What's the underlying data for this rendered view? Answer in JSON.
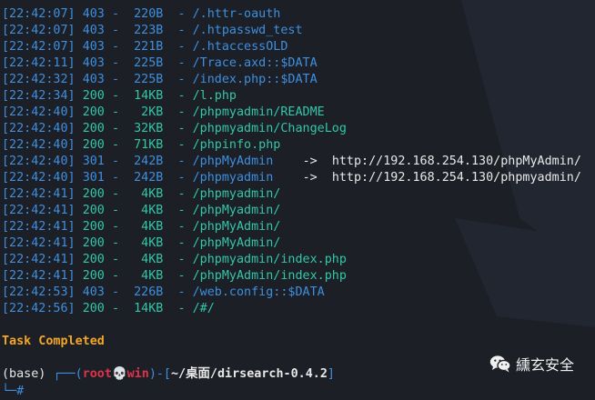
{
  "entries": [
    {
      "ts": "[22:42:07]",
      "code": "403",
      "sep": "-",
      "size": "220B",
      "sep2": "-",
      "path": "/.httr-oauth",
      "redirect": ""
    },
    {
      "ts": "[22:42:07]",
      "code": "403",
      "sep": "-",
      "size": "223B",
      "sep2": "-",
      "path": "/.htpasswd_test",
      "redirect": ""
    },
    {
      "ts": "[22:42:07]",
      "code": "403",
      "sep": "-",
      "size": "221B",
      "sep2": "-",
      "path": "/.htaccessOLD",
      "redirect": ""
    },
    {
      "ts": "[22:42:11]",
      "code": "403",
      "sep": "-",
      "size": "225B",
      "sep2": "-",
      "path": "/Trace.axd::$DATA",
      "redirect": ""
    },
    {
      "ts": "[22:42:32]",
      "code": "403",
      "sep": "-",
      "size": "225B",
      "sep2": "-",
      "path": "/index.php::$DATA",
      "redirect": ""
    },
    {
      "ts": "[22:42:34]",
      "code": "200",
      "sep": "-",
      "size": "14KB",
      "sep2": "-",
      "path": "/l.php",
      "redirect": ""
    },
    {
      "ts": "[22:42:40]",
      "code": "200",
      "sep": "-",
      "size": "2KB",
      "sep2": "-",
      "path": "/phpmyadmin/README",
      "redirect": ""
    },
    {
      "ts": "[22:42:40]",
      "code": "200",
      "sep": "-",
      "size": "32KB",
      "sep2": "-",
      "path": "/phpmyadmin/ChangeLog",
      "redirect": ""
    },
    {
      "ts": "[22:42:40]",
      "code": "200",
      "sep": "-",
      "size": "71KB",
      "sep2": "-",
      "path": "/phpinfo.php",
      "redirect": ""
    },
    {
      "ts": "[22:42:40]",
      "code": "301",
      "sep": "-",
      "size": "242B",
      "sep2": "-",
      "path": "/phpMyAdmin",
      "redirect": "http://192.168.254.130/phpMyAdmin/"
    },
    {
      "ts": "[22:42:40]",
      "code": "301",
      "sep": "-",
      "size": "242B",
      "sep2": "-",
      "path": "/phpmyadmin",
      "redirect": "http://192.168.254.130/phpmyadmin/"
    },
    {
      "ts": "[22:42:41]",
      "code": "200",
      "sep": "-",
      "size": "4KB",
      "sep2": "-",
      "path": "/phpmyadmin/",
      "redirect": ""
    },
    {
      "ts": "[22:42:41]",
      "code": "200",
      "sep": "-",
      "size": "4KB",
      "sep2": "-",
      "path": "/phpMyadmin/",
      "redirect": ""
    },
    {
      "ts": "[22:42:41]",
      "code": "200",
      "sep": "-",
      "size": "4KB",
      "sep2": "-",
      "path": "/phpMyAdmin/",
      "redirect": ""
    },
    {
      "ts": "[22:42:41]",
      "code": "200",
      "sep": "-",
      "size": "4KB",
      "sep2": "-",
      "path": "/phpMyAdmin/",
      "redirect": ""
    },
    {
      "ts": "[22:42:41]",
      "code": "200",
      "sep": "-",
      "size": "4KB",
      "sep2": "-",
      "path": "/phpmyadmin/index.php",
      "redirect": ""
    },
    {
      "ts": "[22:42:41]",
      "code": "200",
      "sep": "-",
      "size": "4KB",
      "sep2": "-",
      "path": "/phpMyAdmin/index.php",
      "redirect": ""
    },
    {
      "ts": "[22:42:53]",
      "code": "403",
      "sep": "-",
      "size": "226B",
      "sep2": "-",
      "path": "/web.config::$DATA",
      "redirect": ""
    },
    {
      "ts": "[22:42:56]",
      "code": "200",
      "sep": "-",
      "size": "14KB",
      "sep2": "-",
      "path": "/#/",
      "redirect": ""
    }
  ],
  "arrow": "->",
  "task_completed": "Task Completed",
  "prompt": {
    "env": "(base)",
    "box_open": "┌──(",
    "user": "root",
    "skull": "💀",
    "host": "win",
    "box_mid": ")-[",
    "path": "~/桌面/dirsearch-0.4.2",
    "box_close": "]"
  },
  "next_prompt": "└─#",
  "watermark": {
    "icon": "wechat-icon",
    "text": "纁玄安全"
  },
  "colors": {
    "background": "#1c1f26",
    "blue": "#3d8fe0",
    "green": "#33c6a8",
    "orange": "#f5a623",
    "red": "#e0334a"
  }
}
